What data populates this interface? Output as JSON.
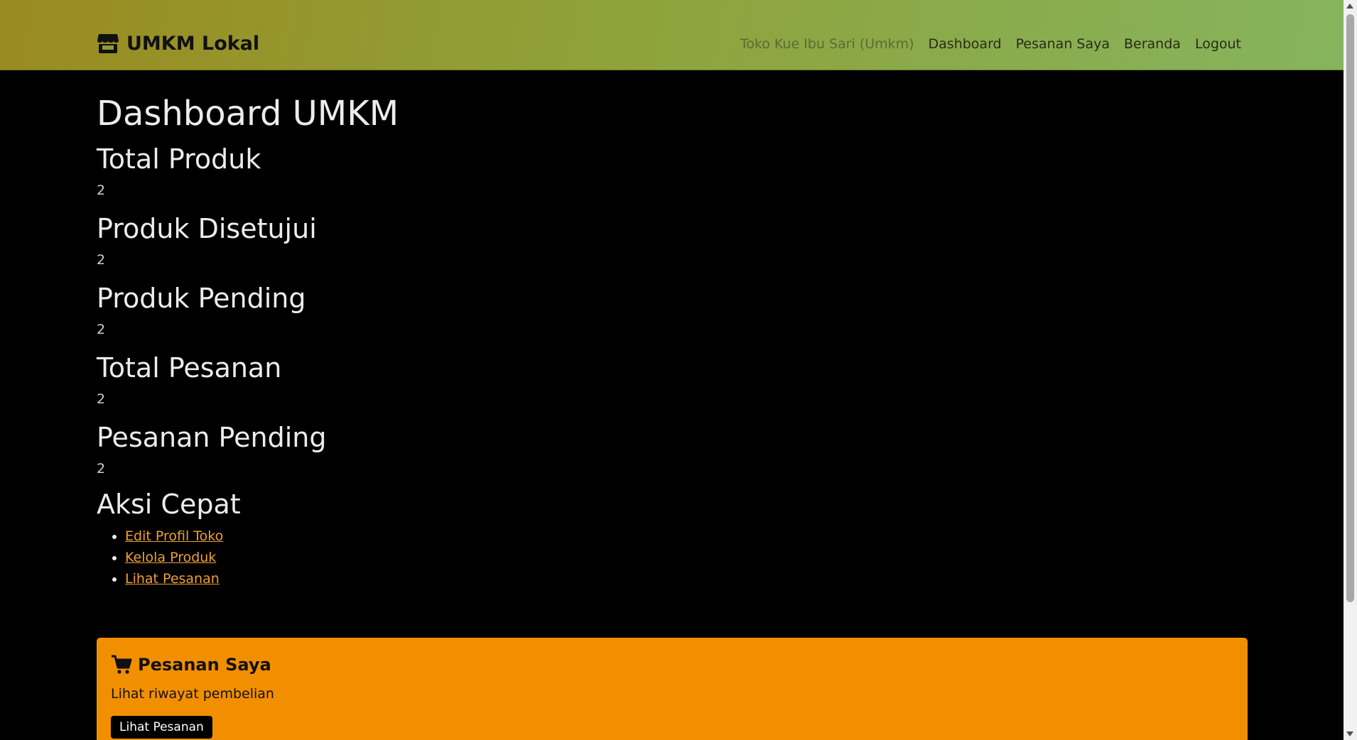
{
  "navbar": {
    "brand": "UMKM Lokal",
    "store_name": "Toko Kue Ibu Sari (Umkm)",
    "links": [
      "Dashboard",
      "Pesanan Saya",
      "Beranda",
      "Logout"
    ]
  },
  "main": {
    "title": "Dashboard UMKM",
    "stats": [
      {
        "label": "Total Produk",
        "value": "2"
      },
      {
        "label": "Produk Disetujui",
        "value": "2"
      },
      {
        "label": "Produk Pending",
        "value": "2"
      },
      {
        "label": "Total Pesanan",
        "value": "2"
      },
      {
        "label": "Pesanan Pending",
        "value": "2"
      }
    ],
    "quick_actions": {
      "title": "Aksi Cepat",
      "links": [
        "Edit Profil Toko",
        "Kelola Produk",
        "Lihat Pesanan"
      ]
    }
  },
  "card": {
    "title": "Pesanan Saya",
    "description": "Lihat riwayat pembelian",
    "button": "Lihat Pesanan"
  },
  "colors": {
    "card_bg": "#f28f00",
    "link": "#f0a030",
    "page_bg": "#000000"
  }
}
